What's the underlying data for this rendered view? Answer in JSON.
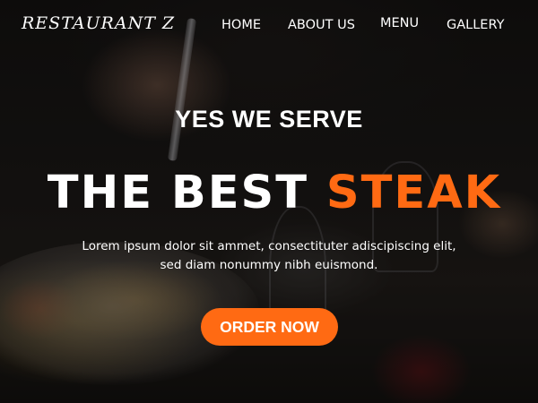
{
  "brand": {
    "logo_text": "RESTAURANT Z"
  },
  "nav": {
    "items": [
      {
        "label": "HOME"
      },
      {
        "label": "ABOUT US"
      },
      {
        "label": "MENU"
      },
      {
        "label": "GALLERY"
      }
    ]
  },
  "hero": {
    "tagline": "YES WE SERVE",
    "headline_white": "THE BEST",
    "headline_accent": "STEAK",
    "description_line1": "Lorem ipsum dolor sit ammet, consectituter adiscipiscing elit,",
    "description_line2": "sed diam nonummy nibh euismond.",
    "cta_label": "ORDER NOW"
  },
  "colors": {
    "accent": "#ff6a13",
    "text": "#ffffff"
  }
}
